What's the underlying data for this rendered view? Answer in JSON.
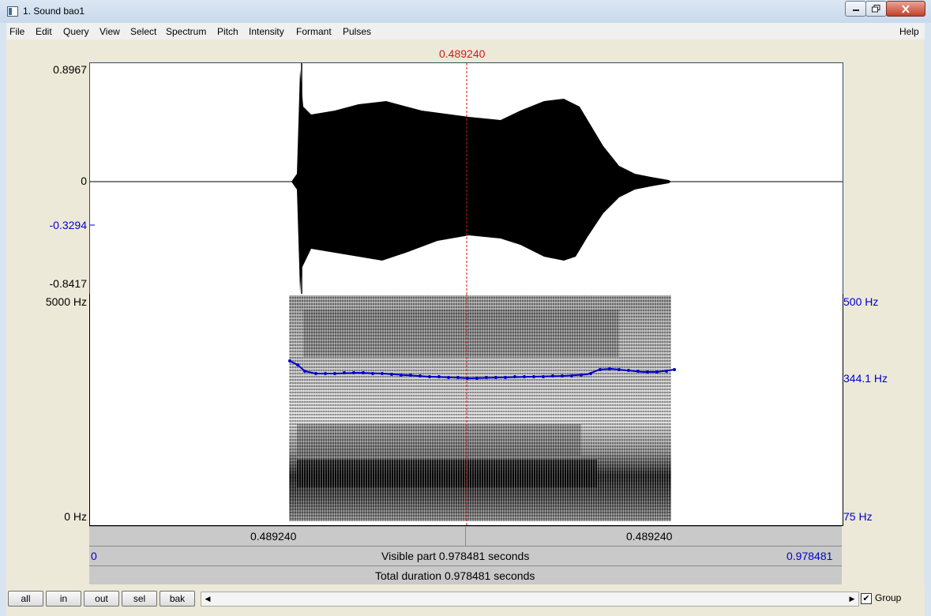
{
  "window": {
    "title": "1. Sound bao1"
  },
  "menu": [
    "File",
    "Edit",
    "Query",
    "View",
    "Select",
    "Spectrum",
    "Pitch",
    "Intensity",
    "Formant",
    "Pulses"
  ],
  "help_label": "Help",
  "cursor_time": "0.489240",
  "waveform": {
    "y_max": "0.8967",
    "y_zero": "0",
    "y_cursor": "-0.3294",
    "y_min": "-0.8417"
  },
  "spectrogram": {
    "freq_top": "5000 Hz",
    "freq_bottom": "0 Hz"
  },
  "pitch": {
    "top": "500 Hz",
    "value": "344.1 Hz",
    "bottom": "75 Hz"
  },
  "time_bar": {
    "left": "0.489240",
    "right": "0.489240"
  },
  "visible_bar": {
    "start": "0",
    "label": "Visible part 0.978481 seconds",
    "end": "0.978481"
  },
  "total_bar": {
    "label": "Total duration 0.978481 seconds"
  },
  "buttons": {
    "all": "all",
    "in": "in",
    "out": "out",
    "sel": "sel",
    "bak": "bak"
  },
  "group": {
    "label": "Group",
    "checked": true
  },
  "colors": {
    "cursor": "#d21a1a",
    "pitch": "#0000cc"
  }
}
